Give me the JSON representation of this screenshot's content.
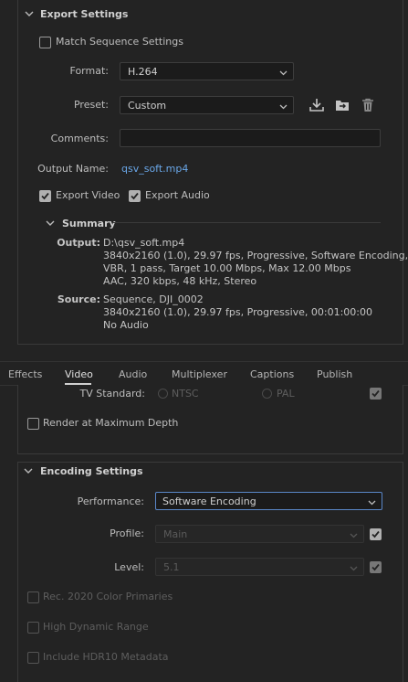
{
  "export_settings": {
    "title": "Export Settings",
    "match_sequence_label": "Match Sequence Settings",
    "format_label": "Format:",
    "format_value": "H.264",
    "preset_label": "Preset:",
    "preset_value": "Custom",
    "comments_label": "Comments:",
    "comments_value": "",
    "output_name_label": "Output Name:",
    "output_name_value": "qsv_soft.mp4",
    "export_video_label": "Export Video",
    "export_audio_label": "Export Audio",
    "export_video_checked": true,
    "export_audio_checked": true,
    "match_sequence_checked": false
  },
  "summary": {
    "title": "Summary",
    "output_key": "Output:",
    "output_lines": [
      "D:\\qsv_soft.mp4",
      "3840x2160 (1.0), 29.97 fps, Progressive, Software Encoding, ...",
      "VBR, 1 pass, Target 10.00 Mbps, Max 12.00 Mbps",
      "AAC, 320 kbps, 48 kHz, Stereo"
    ],
    "source_key": "Source:",
    "source_lines": [
      "Sequence, DJI_0002",
      "3840x2160 (1.0), 29.97 fps, Progressive, 00:01:00:00",
      "No Audio"
    ]
  },
  "tabs": {
    "items": [
      "Effects",
      "Video",
      "Audio",
      "Multiplexer",
      "Captions",
      "Publish"
    ],
    "active": "Video"
  },
  "video": {
    "tv_standard_label": "TV Standard:",
    "ntsc_label": "NTSC",
    "pal_label": "PAL",
    "render_max_depth_label": "Render at Maximum Depth",
    "render_max_depth_checked": false
  },
  "encoding": {
    "title": "Encoding Settings",
    "performance_label": "Performance:",
    "performance_value": "Software Encoding",
    "profile_label": "Profile:",
    "profile_value": "Main",
    "level_label": "Level:",
    "level_value": "5.1",
    "rec2020_label": "Rec. 2020 Color Primaries",
    "hdr_label": "High Dynamic Range",
    "hdr10_label": "Include HDR10 Metadata"
  }
}
